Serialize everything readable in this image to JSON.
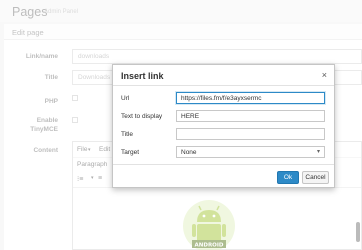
{
  "page": {
    "title": "Pages",
    "subtitle": "Admin Panel"
  },
  "panel": {
    "heading": "Edit page"
  },
  "form": {
    "link_label": "Link/name",
    "link_value": "downloads",
    "title_label": "Title",
    "title_value": "Downloads",
    "php_label": "PHP",
    "tinymce_label_1": "Enable",
    "tinymce_label_2": "TinyMCE",
    "content_label": "Content"
  },
  "editor": {
    "menu": [
      "File",
      "Edit"
    ],
    "format_select": "Paragraph",
    "image_text": "ANDROID"
  },
  "dialog": {
    "title": "Insert link",
    "close": "×",
    "url_label": "Url",
    "url_value": "https://files.fm/f/e3ayxsermc",
    "text_label": "Text to display",
    "text_value": "HERE",
    "title_label": "Title",
    "title_value": "",
    "target_label": "Target",
    "target_value": "None",
    "ok_label": "Ok",
    "cancel_label": "Cancel"
  },
  "colors": {
    "accent": "#2d8ac7",
    "android_green": "#a4c639"
  }
}
